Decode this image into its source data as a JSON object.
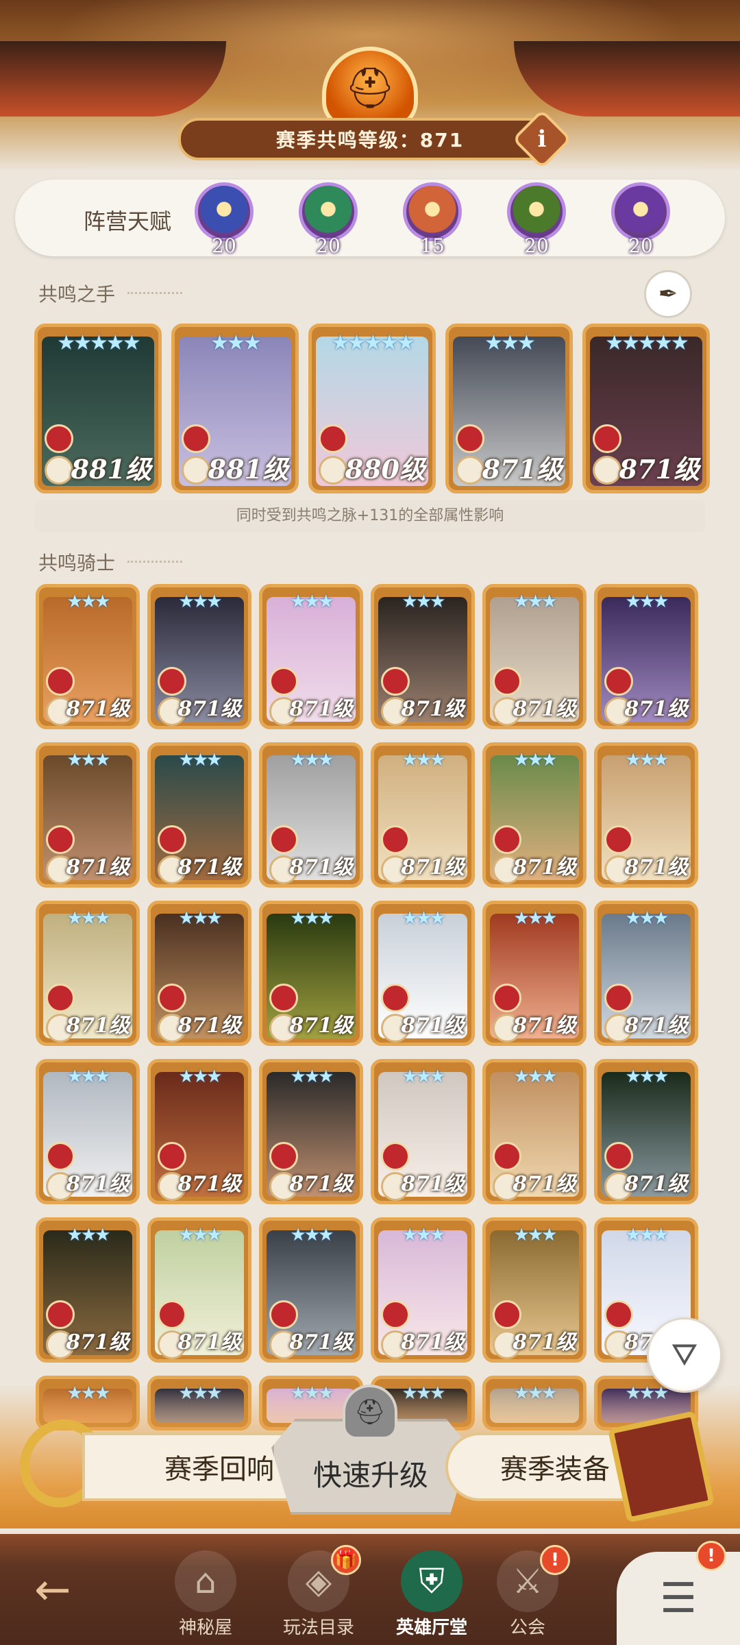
{
  "header": {
    "level_text": "赛季共鸣等级：871",
    "info_label": "i"
  },
  "faction_talents": {
    "label": "阵营天赋",
    "badges": [
      {
        "value": "20",
        "color": "#3a4fb0",
        "icon": "lightbearer-icon"
      },
      {
        "value": "20",
        "color": "#2f8a5a",
        "icon": "wilder-icon"
      },
      {
        "value": "15",
        "color": "#d2643a",
        "icon": "mauler-icon"
      },
      {
        "value": "20",
        "color": "#4a7a2a",
        "icon": "graveborn-icon"
      },
      {
        "value": "20",
        "color": "#6a3aa0",
        "icon": "celestial-hypogean-icon"
      }
    ]
  },
  "resonance_hand": {
    "title": "共鸣之手",
    "hint": "同时受到共鸣之脉+131的全部属性影响",
    "heroes": [
      {
        "level": "881级",
        "stars": "★★★★★"
      },
      {
        "level": "881级",
        "stars": "★★★"
      },
      {
        "level": "880级",
        "stars": "★★★★★"
      },
      {
        "level": "871级",
        "stars": "★★★"
      },
      {
        "level": "871级",
        "stars": "★★★★★"
      }
    ]
  },
  "resonance_knights": {
    "title": "共鸣骑士",
    "level": "871级",
    "stars": "★★★"
  },
  "actions": {
    "left": "赛季回响",
    "center": "快速升级",
    "right": "赛季装备"
  },
  "nav": {
    "items": [
      {
        "label": "神秘屋",
        "icon": "mystery-house-icon"
      },
      {
        "label": "玩法目录",
        "icon": "game-modes-icon",
        "badge": "gift"
      },
      {
        "label": "英雄厅堂",
        "icon": "hero-hall-icon"
      },
      {
        "label": "公会",
        "icon": "guild-icon",
        "badge": "!"
      }
    ],
    "menu_badge": "!"
  }
}
